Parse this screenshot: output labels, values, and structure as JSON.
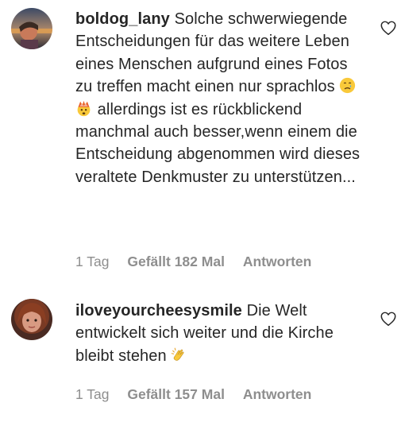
{
  "comments": [
    {
      "username": "boldog_lany",
      "text_part1": "Solche schwerwiegende Entscheidungen für das weitere Leben eines Menschen aufgrund eines Fotos zu treffen macht einen nur sprachlos",
      "emojis": [
        "crying-face-emoji",
        "exploding-head-emoji"
      ],
      "text_part2": "allerdings ist es rückblickend manchmal auch besser,wenn einem die Entscheidung abgenommen wird dieses veraltete Denkmuster zu unterstützen...",
      "time": "1 Tag",
      "likes": "Gefällt 182 Mal",
      "reply": "Antworten"
    },
    {
      "username": "iloveyourcheesysmile",
      "text_part1": "Die Welt entwickelt sich weiter und die Kirche bleibt stehen",
      "emojis": [
        "clapping-hands-emoji"
      ],
      "time": "1 Tag",
      "likes": "Gefällt 157 Mal",
      "reply": "Antworten"
    }
  ],
  "colors": {
    "text": "#262626",
    "meta": "#8e8e8e"
  }
}
